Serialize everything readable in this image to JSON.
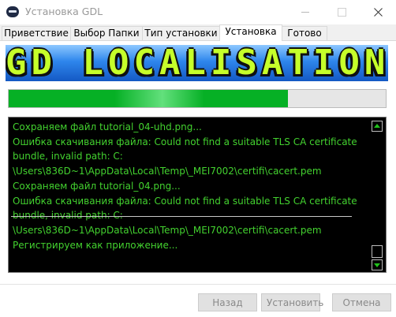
{
  "window": {
    "title": "Установка GDL"
  },
  "tabs": [
    {
      "label": "Приветствие",
      "active": false
    },
    {
      "label": "Выбор Папки",
      "active": false
    },
    {
      "label": "Тип установки",
      "active": false
    },
    {
      "label": "Установка",
      "active": true
    },
    {
      "label": "Готово",
      "active": false
    }
  ],
  "banner": {
    "text": "GD LOCALISATION"
  },
  "progress": {
    "value_fraction": 0.74,
    "color": "#06b025"
  },
  "log": {
    "text_color": "#43d22f",
    "lines": [
      "Сохраняем файл tutorial_04-uhd.png...",
      "Ошибка скачивания файла: Could not find a suitable TLS CA certificate",
      "bundle, invalid path: C:",
      "\\Users\\836D~1\\AppData\\Local\\Temp\\_MEI7002\\certifi\\cacert.pem",
      "Сохраняем файл tutorial_04.png...",
      "Ошибка скачивания файла: Could not find a suitable TLS CA certificate",
      "bundle, invalid path: C:",
      "\\Users\\836D~1\\AppData\\Local\\Temp\\_MEI7002\\certifi\\cacert.pem",
      "Регистрируем как приложение..."
    ]
  },
  "buttons": {
    "back_label": "Назад",
    "install_label": "Установить",
    "cancel_label": "Отмена"
  }
}
